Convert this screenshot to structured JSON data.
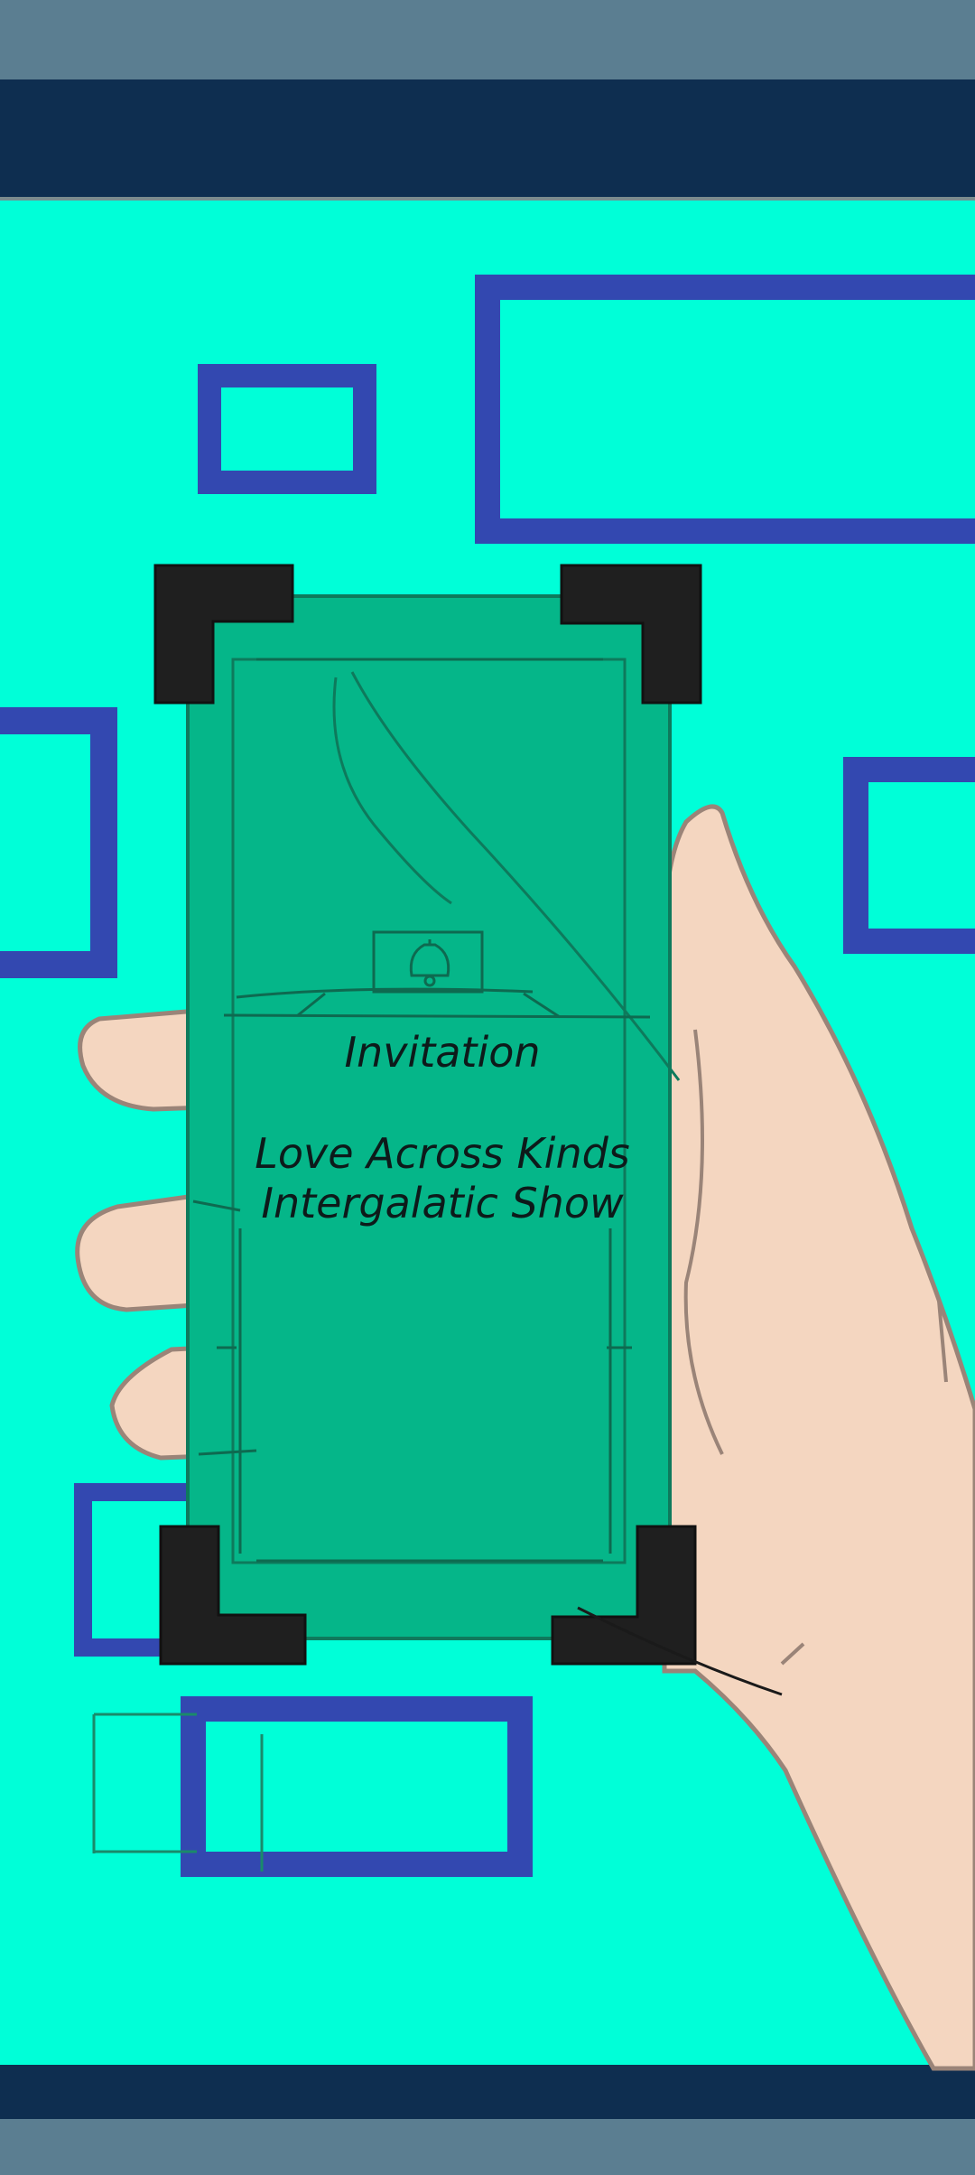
{
  "invitation": {
    "heading": "Invitation",
    "title_line1": "Love Across Kinds",
    "title_line2": "Intergalatic Show"
  },
  "colors": {
    "background": "#00ffd8",
    "frame_blue": "#3348b0",
    "card_green": "#05b689",
    "corner_black": "#1f1f1f",
    "skin": "#f4d6c0",
    "bar_dark": "#0e2e50",
    "bar_gray": "#5b7e91"
  },
  "icons": {
    "bell": "bell-icon"
  }
}
